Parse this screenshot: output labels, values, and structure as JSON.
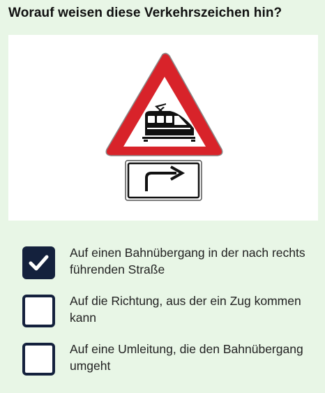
{
  "question": {
    "text": "Worauf weisen diese Verkehrszeichen hin?"
  },
  "image": {
    "main_sign_icon": "train-warning-sign",
    "sub_sign_icon": "arrow-right-turn-sign"
  },
  "answers": [
    {
      "text": "Auf einen Bahnübergang in der nach rechts führenden Straße",
      "checked": true
    },
    {
      "text": "Auf die Richtung, aus der ein Zug kommen kann",
      "checked": false
    },
    {
      "text": "Auf eine Umleitung, die den Bahnübergang umgeht",
      "checked": false
    }
  ],
  "colors": {
    "background": "#e8f6e6",
    "checkbox": "#14213d",
    "sign_red": "#d8232a"
  }
}
